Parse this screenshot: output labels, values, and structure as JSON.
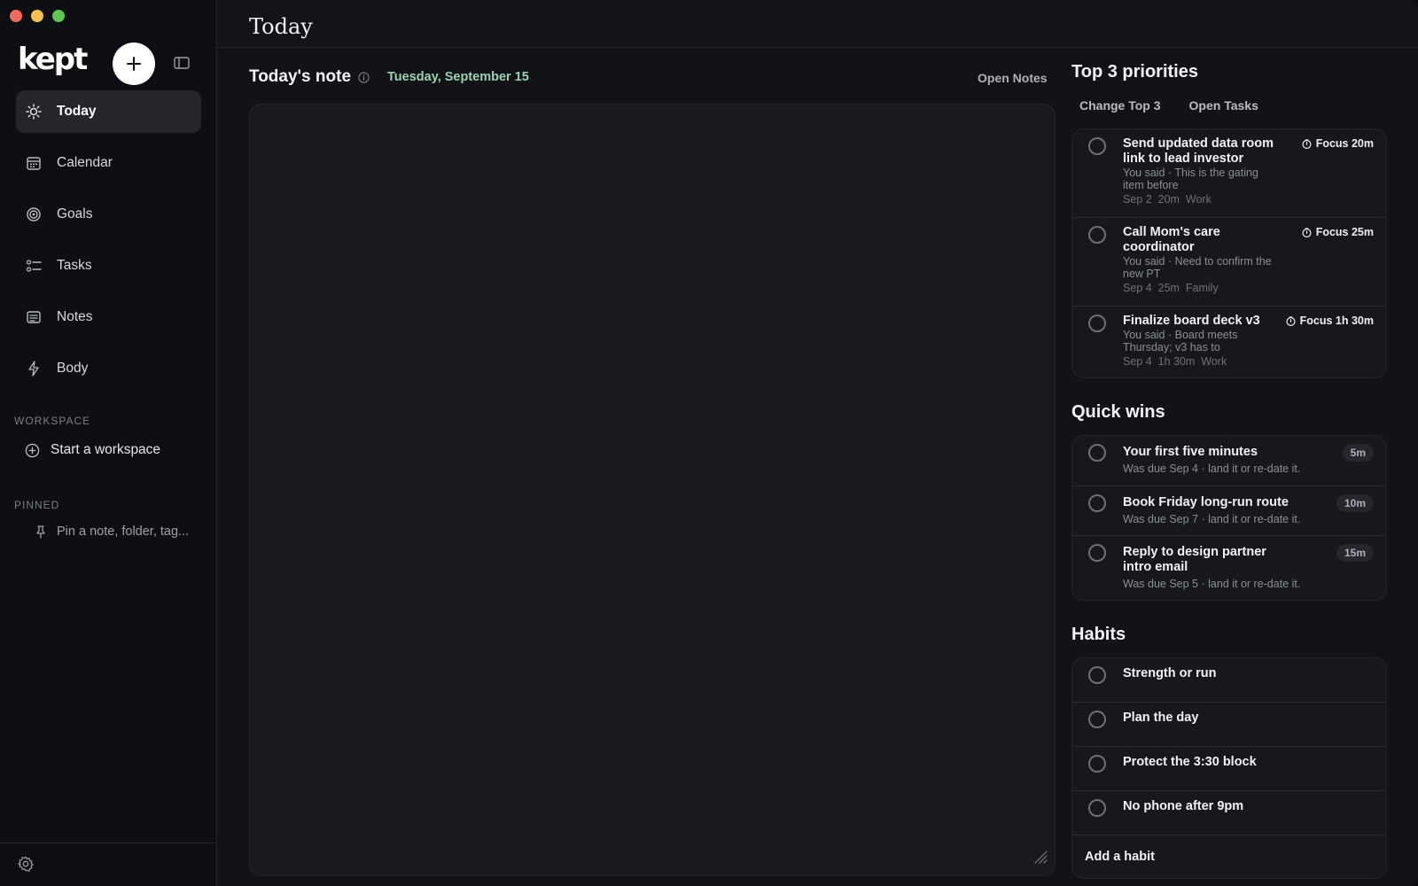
{
  "app": {
    "logo": "kept"
  },
  "header": {
    "title": "Today"
  },
  "sidebar": {
    "items": [
      {
        "label": "Today",
        "icon": "sun-icon",
        "active": true
      },
      {
        "label": "Calendar",
        "icon": "calendar-icon"
      },
      {
        "label": "Goals",
        "icon": "target-icon"
      },
      {
        "label": "Tasks",
        "icon": "checklist-icon"
      },
      {
        "label": "Notes",
        "icon": "notes-icon"
      },
      {
        "label": "Body",
        "icon": "bolt-icon"
      }
    ],
    "workspace_label": "WORKSPACE",
    "start_workspace": "Start a workspace",
    "pinned_label": "PINNED",
    "pin_placeholder": "Pin a note, folder, tag..."
  },
  "note": {
    "title": "Today's note",
    "date": "Tuesday, September 15",
    "open_notes": "Open Notes"
  },
  "priorities": {
    "title": "Top 3 priorities",
    "tab_change": "Change Top 3",
    "tab_open": "Open Tasks",
    "items": [
      {
        "title_line1": "Send updated data room",
        "title_line2": "link to lead investor",
        "focus": "Focus 20m",
        "sub_line1": "You said · This is the gating",
        "sub_line2": "item before",
        "date": "Sep 2",
        "duration": "20m",
        "tag": "Work"
      },
      {
        "title_line1": "Call Mom's care",
        "title_line2": "coordinator",
        "focus": "Focus 25m",
        "sub_line1": "You said · Need to confirm the",
        "sub_line2": "new PT",
        "date": "Sep 4",
        "duration": "25m",
        "tag": "Family"
      },
      {
        "title_line1": "Finalize board deck v3",
        "title_line2": "",
        "focus": "Focus 1h 30m",
        "sub_line1": "You said · Board meets",
        "sub_line2": "Thursday; v3 has to",
        "date": "Sep 4",
        "duration": "1h 30m",
        "tag": "Work"
      }
    ]
  },
  "quick_wins": {
    "title": "Quick wins",
    "items": [
      {
        "title_line1": "Your first five minutes",
        "title_line2": "",
        "sub": "Was due Sep 4 · land it or re-date it.",
        "badge": "5m"
      },
      {
        "title_line1": "Book Friday long-run route",
        "title_line2": "",
        "sub": "Was due Sep 7 · land it or re-date it.",
        "badge": "10m"
      },
      {
        "title_line1": "Reply to design partner",
        "title_line2": "intro email",
        "sub": "Was due Sep 5 · land it or re-date it.",
        "badge": "15m"
      }
    ]
  },
  "habits": {
    "title": "Habits",
    "items": [
      "Strength or run",
      "Plan the day",
      "Protect the 3:30 block",
      "No phone after 9pm"
    ],
    "add_label": "Add a habit"
  }
}
